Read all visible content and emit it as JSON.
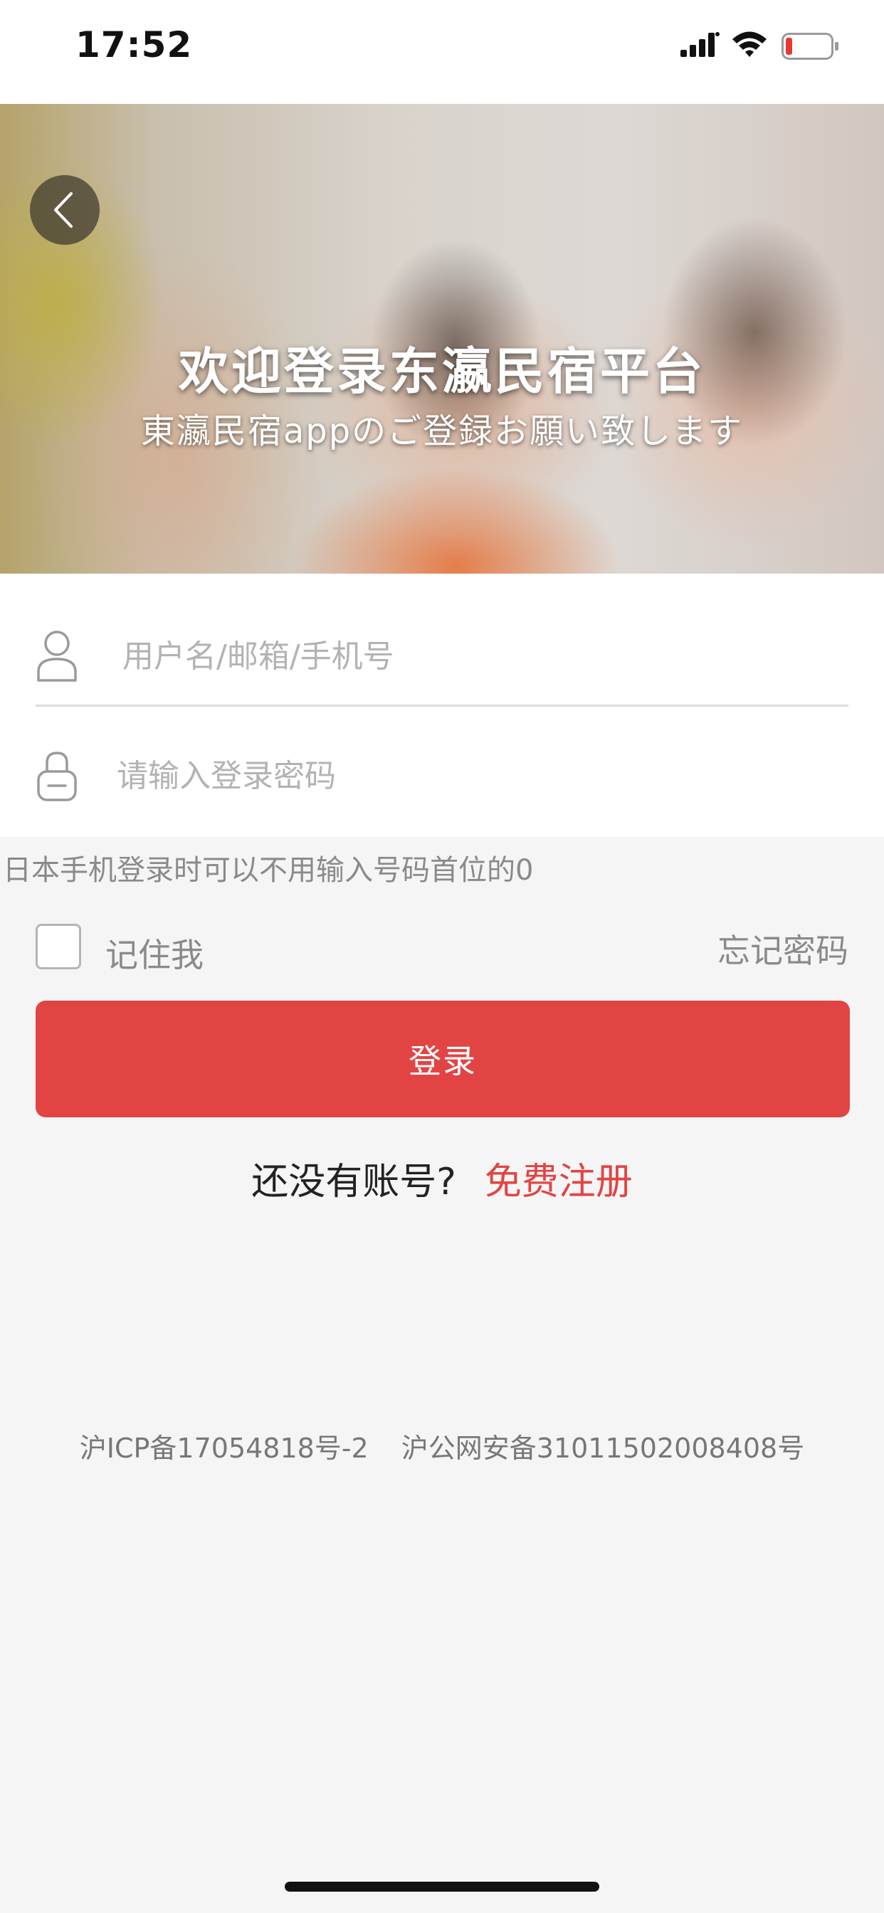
{
  "status_bar": {
    "time": "17:52"
  },
  "banner": {
    "title": "欢迎登录东瀛民宿平台",
    "subtitle": "東瀛民宿appのご登録お願い致します"
  },
  "form": {
    "username_placeholder": "用户名/邮箱/手机号",
    "password_placeholder": "请输入登录密码",
    "hint": "日本手机登录时可以不用输入号码首位的0",
    "remember_label": "记住我",
    "forgot_label": "忘记密码",
    "login_label": "登录"
  },
  "register": {
    "prompt": "还没有账号?",
    "link": "免费注册"
  },
  "footer": {
    "icp": "沪ICP备17054818号-2",
    "police": "沪公网安备31011502008408号"
  },
  "colors": {
    "accent": "#e24444",
    "background": "#f5f5f5"
  }
}
